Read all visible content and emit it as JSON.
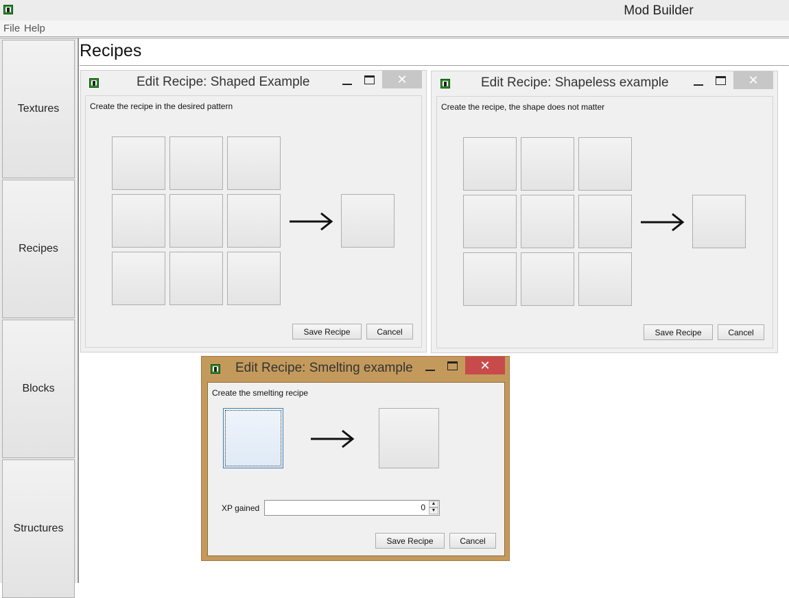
{
  "app": {
    "title": "Mod Builder",
    "icon": "app-logo-icon",
    "menu": [
      "File",
      "Help"
    ]
  },
  "sidebar": {
    "items": [
      {
        "label": "Textures"
      },
      {
        "label": "Recipes"
      },
      {
        "label": "Blocks"
      },
      {
        "label": "Structures"
      }
    ]
  },
  "page": {
    "title": "Recipes"
  },
  "windows": {
    "shaped": {
      "title": "Edit Recipe: Shaped Example",
      "description": "Create the recipe in the desired pattern",
      "save_label": "Save Recipe",
      "cancel_label": "Cancel",
      "close_glyph": "✕"
    },
    "shapeless": {
      "title": "Edit Recipe: Shapeless example",
      "description": "Create the recipe, the shape does not matter",
      "save_label": "Save Recipe",
      "cancel_label": "Cancel",
      "close_glyph": "✕"
    },
    "smelting": {
      "title": "Edit Recipe: Smelting example",
      "description": "Create the smelting recipe",
      "xp_label": "XP gained",
      "xp_value": "0",
      "save_label": "Save Recipe",
      "cancel_label": "Cancel",
      "close_glyph": "✕"
    }
  },
  "colors": {
    "active_frame": "#c49a5c",
    "close_active": "#c84b4b",
    "close_inactive": "#c7c7c7"
  }
}
